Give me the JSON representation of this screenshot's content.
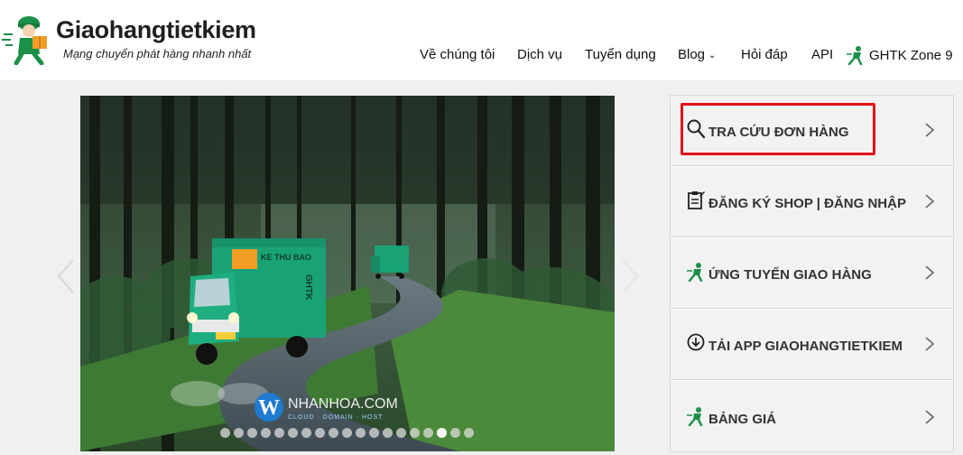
{
  "brand": {
    "title": "Giaohangtietkiem",
    "tagline": "Mạng chuyển phát hàng nhanh nhất",
    "color": "#1a9048"
  },
  "nav": {
    "items": [
      {
        "label": "Về chúng tôi"
      },
      {
        "label": "Dịch vụ"
      },
      {
        "label": "Tuyển dụng"
      },
      {
        "label": "Blog",
        "has_dropdown": true
      },
      {
        "label": "Hỏi đáp"
      },
      {
        "label": "API"
      },
      {
        "label": "GHTK Zone 9",
        "icon": "shipper-icon"
      }
    ]
  },
  "slider": {
    "truck_label": "KE THU BAO",
    "truck_side_label": "GHTK",
    "watermark_letter": "W",
    "watermark_text": "NHANHOA.COM",
    "watermark_sub": "CLOUD · DOMAIN · HOST",
    "dot_count": 19,
    "active_dot": 16
  },
  "menu": {
    "items": [
      {
        "label": "TRA CỨU ĐƠN HÀNG",
        "icon": "search-icon"
      },
      {
        "label": "ĐĂNG KÝ SHOP | ĐĂNG NHẬP",
        "icon": "clipboard-icon"
      },
      {
        "label": "ỨNG TUYỂN GIAO HÀNG",
        "icon": "shipper-icon"
      },
      {
        "label": "TẢI APP GIAOHANGTIETKIEM",
        "icon": "download-icon"
      },
      {
        "label": "BẢNG GIÁ",
        "icon": "shipper-icon"
      }
    ],
    "highlighted_index": 0,
    "highlight_color": "#e0141b"
  }
}
